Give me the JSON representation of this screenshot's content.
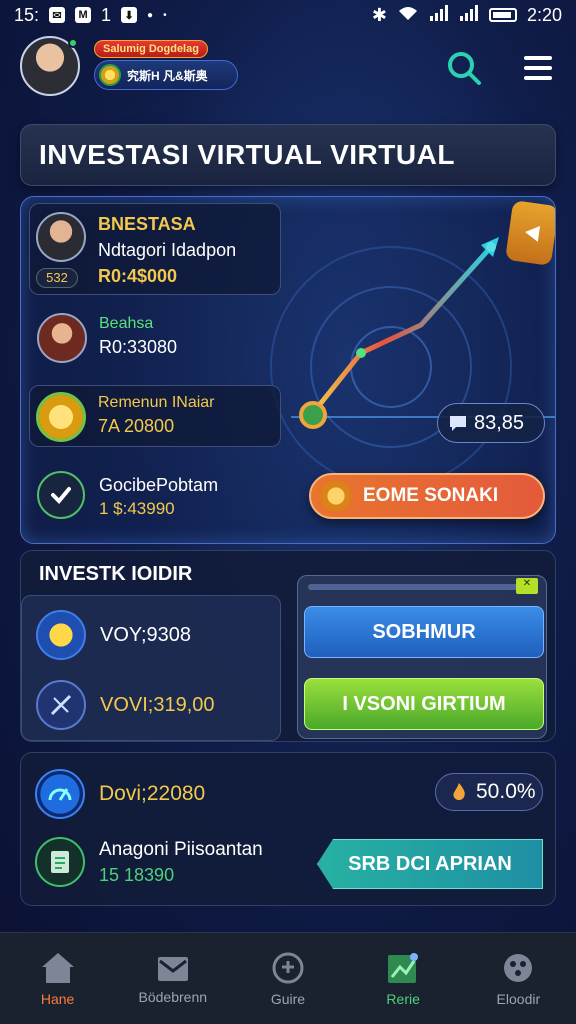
{
  "status_bar": {
    "left_text": "15:",
    "notif_2": "1",
    "time": "2:20"
  },
  "header": {
    "badge_red": "Salumig Dogdelag",
    "badge_blue": "究斯H 凡&斯奥",
    "search_icon": "search-icon",
    "menu_icon": "menu-icon"
  },
  "title": "INVESTASI VIRTUAL VIRTUAL",
  "cards": [
    {
      "title": "BNESTASA",
      "subtitle": "Ndtagori Idadpon",
      "badge": "532",
      "value": "R0:4$000"
    },
    {
      "title": "Beahsa",
      "value": "R0:33080"
    },
    {
      "title": "Remenun INaiar",
      "value": "7A 20800"
    },
    {
      "title": "GocibePobtam",
      "value": "1 $:43990"
    }
  ],
  "graph": {
    "value_badge": "83,85",
    "action_button": "EOME SONAKI"
  },
  "invest_panel": {
    "title": "INVESTK IOIDIR",
    "row1_value": "VOY;9308",
    "row2_value": "VOVI;319,00",
    "button_blue": "SOBHMUR",
    "button_green": "I VSONI GIRTIUM"
  },
  "bottom_panel": {
    "row1_value": "Dovi;22080",
    "percent": "50.0%",
    "row2_title": "Anagoni Piisoantan",
    "row2_value": "15 18390",
    "action_button": "SRB DCI APRIAN"
  },
  "nav": [
    {
      "label": "Hane",
      "icon": "home-icon"
    },
    {
      "label": "Bödebrenn",
      "icon": "inbox-icon"
    },
    {
      "label": "Guire",
      "icon": "compass-icon"
    },
    {
      "label": "Rerie",
      "icon": "chart-icon"
    },
    {
      "label": "Eloodir",
      "icon": "settings-icon"
    }
  ],
  "colors": {
    "accent_teal": "#2ad1b3",
    "accent_orange": "#e8742d",
    "accent_green": "#4fd07a",
    "panel_border": "#4a6dc8"
  }
}
